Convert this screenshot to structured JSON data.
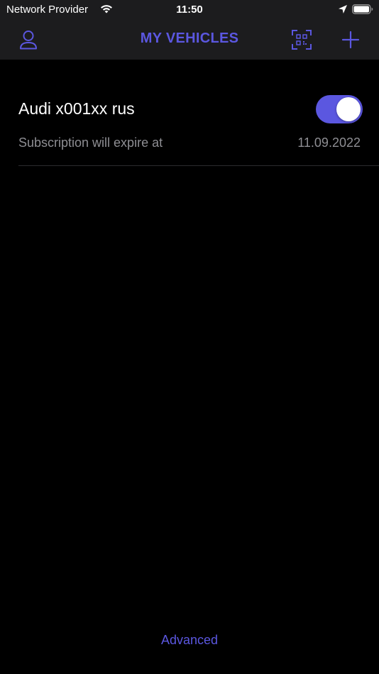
{
  "status_bar": {
    "carrier": "Network Provider",
    "time": "11:50",
    "icons": [
      "wifi-icon",
      "location-arrow-icon",
      "battery-icon"
    ]
  },
  "nav": {
    "title": "MY VEHICLES",
    "left_icon": "person-icon",
    "right_icons": [
      "qr-code-scan-icon",
      "plus-icon"
    ]
  },
  "vehicles": [
    {
      "name": "Audi x001xx rus",
      "enabled": true,
      "subscription_label": "Subscription will expire at",
      "subscription_date": "11.09.2022"
    }
  ],
  "footer": {
    "advanced_label": "Advanced"
  },
  "colors": {
    "accent": "#5b57e0",
    "background": "#000000",
    "bar_background": "#1c1c1e",
    "secondary_text": "#8e8e93"
  }
}
